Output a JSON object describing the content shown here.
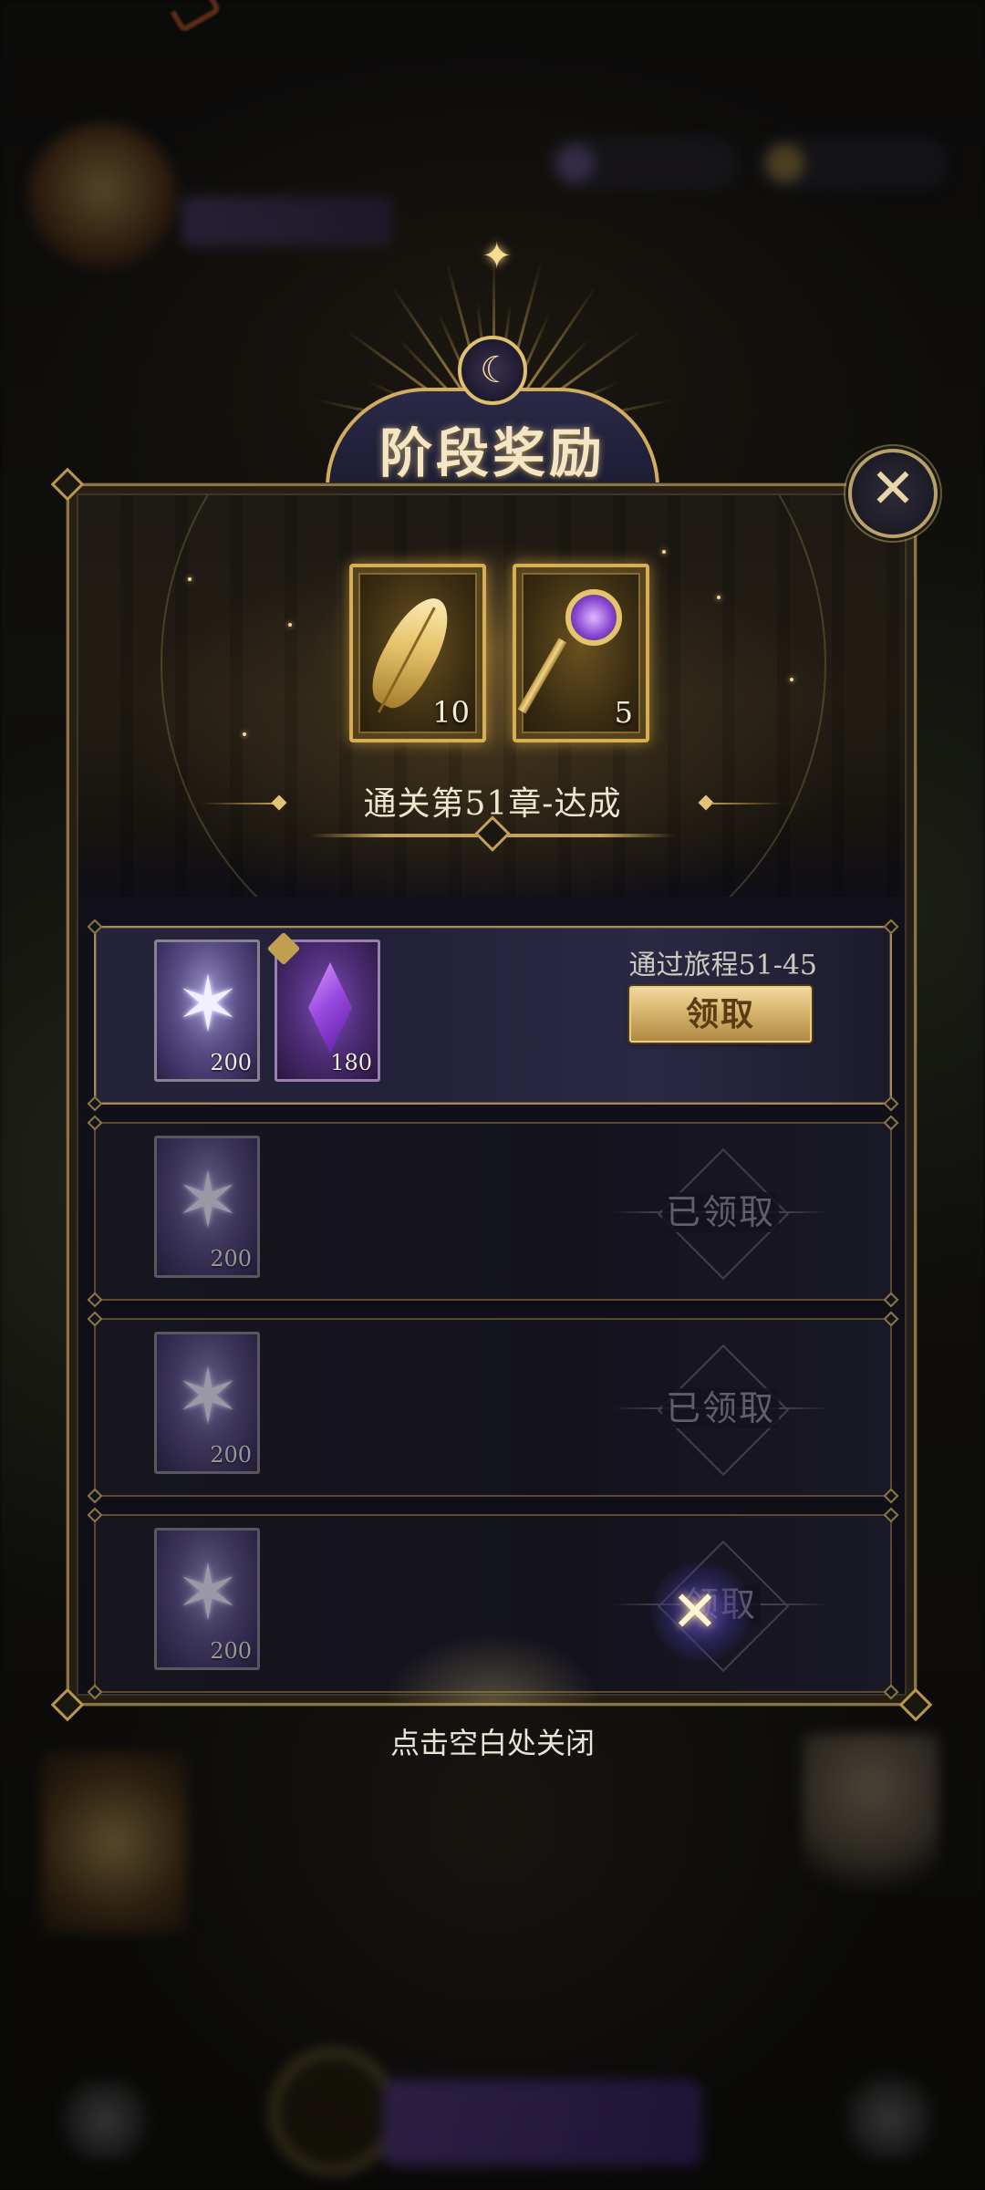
{
  "dialog": {
    "title": "阶段奖励",
    "stage_label": "通关第51章-达成",
    "stage_rewards": [
      {
        "icon": "golden-feather-icon",
        "count": "10"
      },
      {
        "icon": "jeweled-key-icon",
        "count": "5"
      }
    ],
    "rows": [
      {
        "condition": "通过旅程51-45",
        "status": "claimable",
        "button_label": "领取",
        "items": [
          {
            "icon": "crystal-star-icon",
            "qty": "200"
          },
          {
            "icon": "purple-gem-icon",
            "qty": "180"
          }
        ]
      },
      {
        "status": "claimed",
        "stamp_label": "已领取",
        "items": [
          {
            "icon": "crystal-star-icon",
            "qty": "200"
          }
        ]
      },
      {
        "status": "claimed",
        "stamp_label": "已领取",
        "items": [
          {
            "icon": "crystal-star-icon",
            "qty": "200"
          }
        ]
      },
      {
        "status": "claimed",
        "stamp_label": "领取",
        "items": [
          {
            "icon": "crystal-star-icon",
            "qty": "200"
          }
        ]
      }
    ],
    "close_hint": "点击空白处关闭"
  },
  "colors": {
    "gold_accent": "#d2ad5c",
    "claim_button": "#d6b46c",
    "panel_bg": "#14131c"
  }
}
